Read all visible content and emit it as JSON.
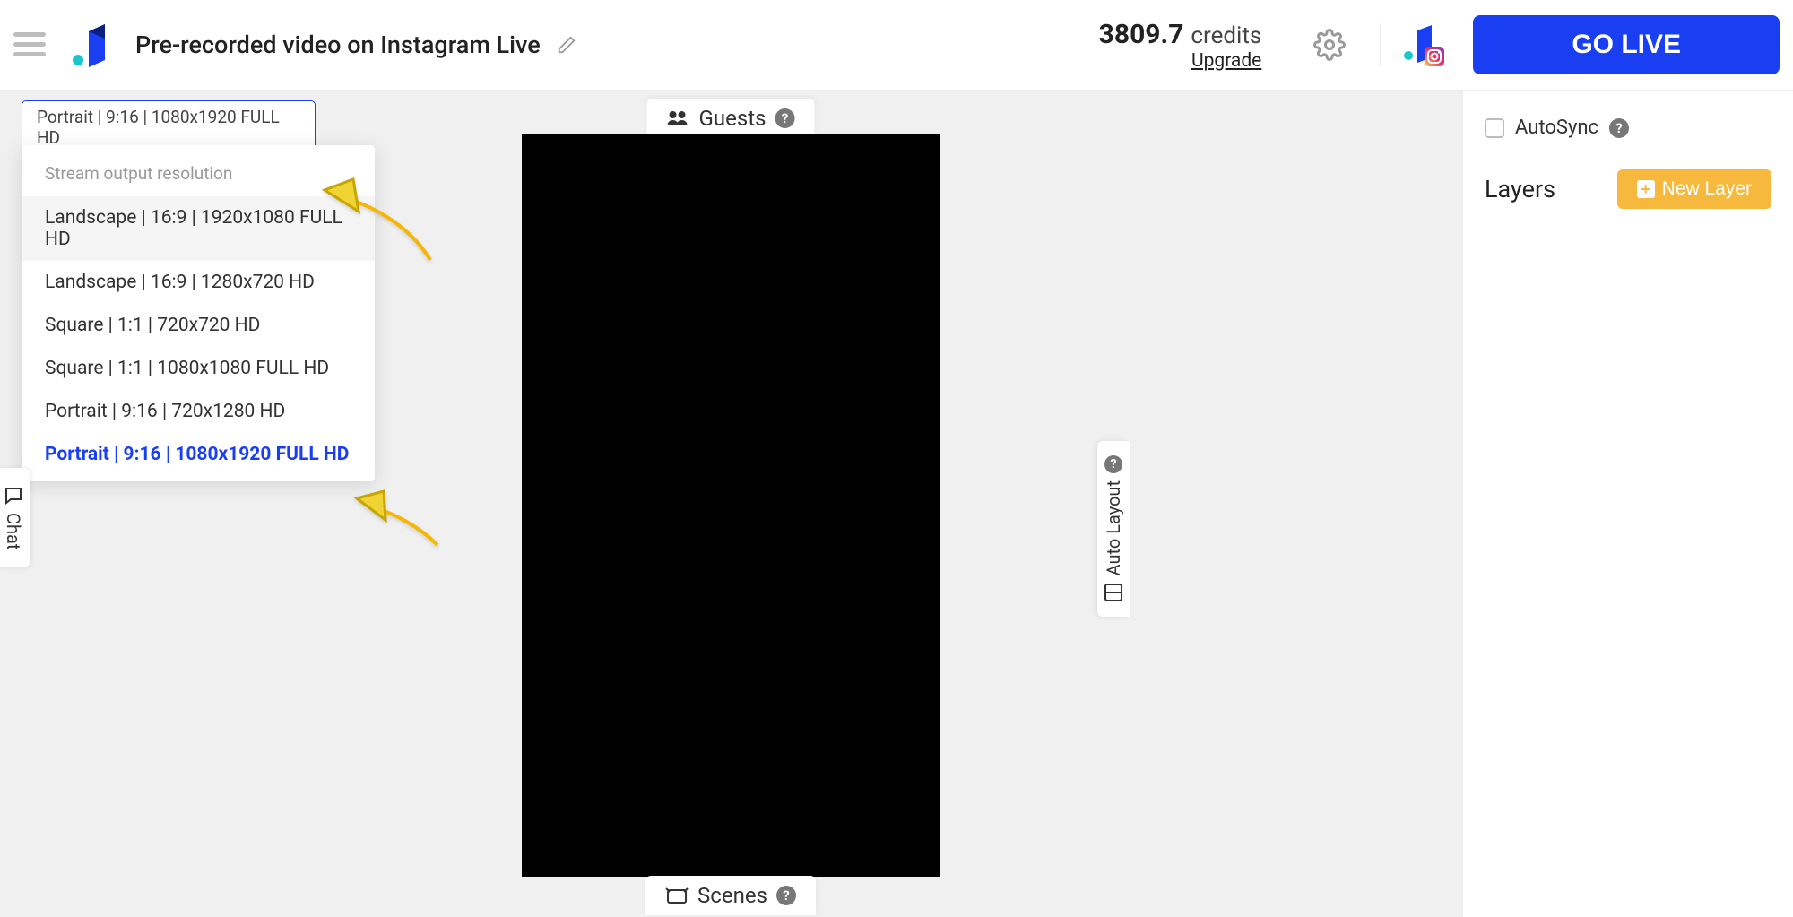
{
  "header": {
    "title": "Pre-recorded video on Instagram Live",
    "credits_value": "3809.7",
    "credits_label": "credits",
    "upgrade": "Upgrade",
    "go_live": "GO LIVE"
  },
  "resolution": {
    "selected": "Portrait | 9:16 | 1080x1920 FULL HD",
    "dropdown_header": "Stream output resolution",
    "options": [
      "Landscape | 16:9 | 1920x1080 FULL HD",
      "Landscape | 16:9 | 1280x720 HD",
      "Square | 1:1 | 720x720 HD",
      "Square | 1:1 | 1080x1080 FULL HD",
      "Portrait | 9:16 | 720x1280 HD",
      "Portrait | 9:16 | 1080x1920 FULL HD"
    ]
  },
  "tabs": {
    "guests": "Guests",
    "scenes": "Scenes",
    "chat": "Chat",
    "auto_layout": "Auto Layout"
  },
  "right": {
    "autosync": "AutoSync",
    "layers": "Layers",
    "new_layer": "New Layer"
  }
}
